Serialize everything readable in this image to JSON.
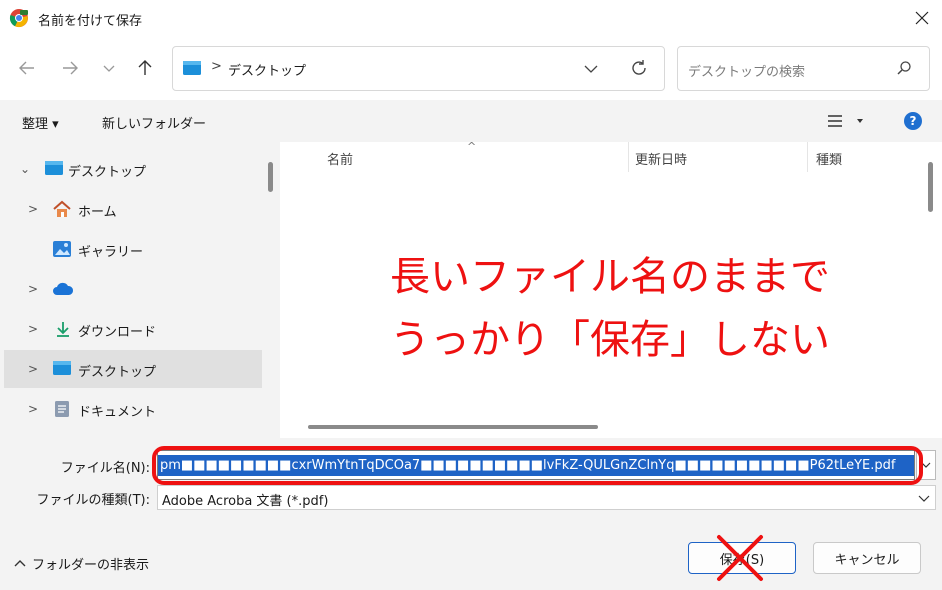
{
  "window": {
    "title": "名前を付けて保存",
    "icon": "chrome-app-icon",
    "close_icon": "close-icon"
  },
  "nav": {
    "back_icon": "back-arrow-icon",
    "forward_icon": "forward-arrow-icon",
    "recent_icon": "chevron-down-icon",
    "up_icon": "up-arrow-icon",
    "address_separator": ">",
    "address_path": "デスクトップ",
    "refresh_icon": "refresh-icon",
    "search_placeholder": "デスクトップの検索"
  },
  "toolbar": {
    "organize_label": "整理 ▾",
    "new_folder_label": "新しいフォルダー",
    "view_icon": "list-view-icon",
    "help_label": "?"
  },
  "sidebar": {
    "items": [
      {
        "label": "デスクトップ",
        "icon": "desktop-folder-icon",
        "expander": "⌄",
        "selected": false
      },
      {
        "label": "ホーム",
        "icon": "home-icon",
        "expander": ">",
        "selected": false
      },
      {
        "label": "ギャラリー",
        "icon": "gallery-icon",
        "expander": "",
        "selected": false
      },
      {
        "label": "",
        "icon": "onedrive-cloud-icon",
        "expander": ">",
        "selected": false
      },
      {
        "label": "ダウンロード",
        "icon": "download-icon",
        "expander": ">",
        "selected": false
      },
      {
        "label": "デスクトップ",
        "icon": "desktop-folder-icon",
        "expander": ">",
        "selected": true
      },
      {
        "label": "ドキュメント",
        "icon": "document-icon",
        "expander": ">",
        "selected": false
      }
    ]
  },
  "filepane": {
    "columns": [
      "名前",
      "更新日時",
      "種類"
    ],
    "sort_indicator": "^"
  },
  "annotation": {
    "line1": "長いファイル名のままで",
    "line2": "うっかり「保存」しない",
    "color": "#ee1111"
  },
  "form": {
    "filename_label": "ファイル名(N):",
    "filename_value": "pm■■■■■■■■■cxrWmYtnTqDCOa7■■■■■■■■■■lvFkZ-QULGnZClnYq■■■■■■■■■■■P62tLeYE.pdf",
    "filetype_label": "ファイルの種類(T):",
    "filetype_value": "Adobe Acroba 文書 (*.pdf)"
  },
  "footer": {
    "hide_folders_label": "フォルダーの非表示",
    "save_label": "保存(S)",
    "cancel_label": "キャンセル"
  },
  "colors": {
    "selection_blue": "#1e63c6",
    "accent_blue": "#1f6fd0",
    "annotation_red": "#ee1111"
  }
}
